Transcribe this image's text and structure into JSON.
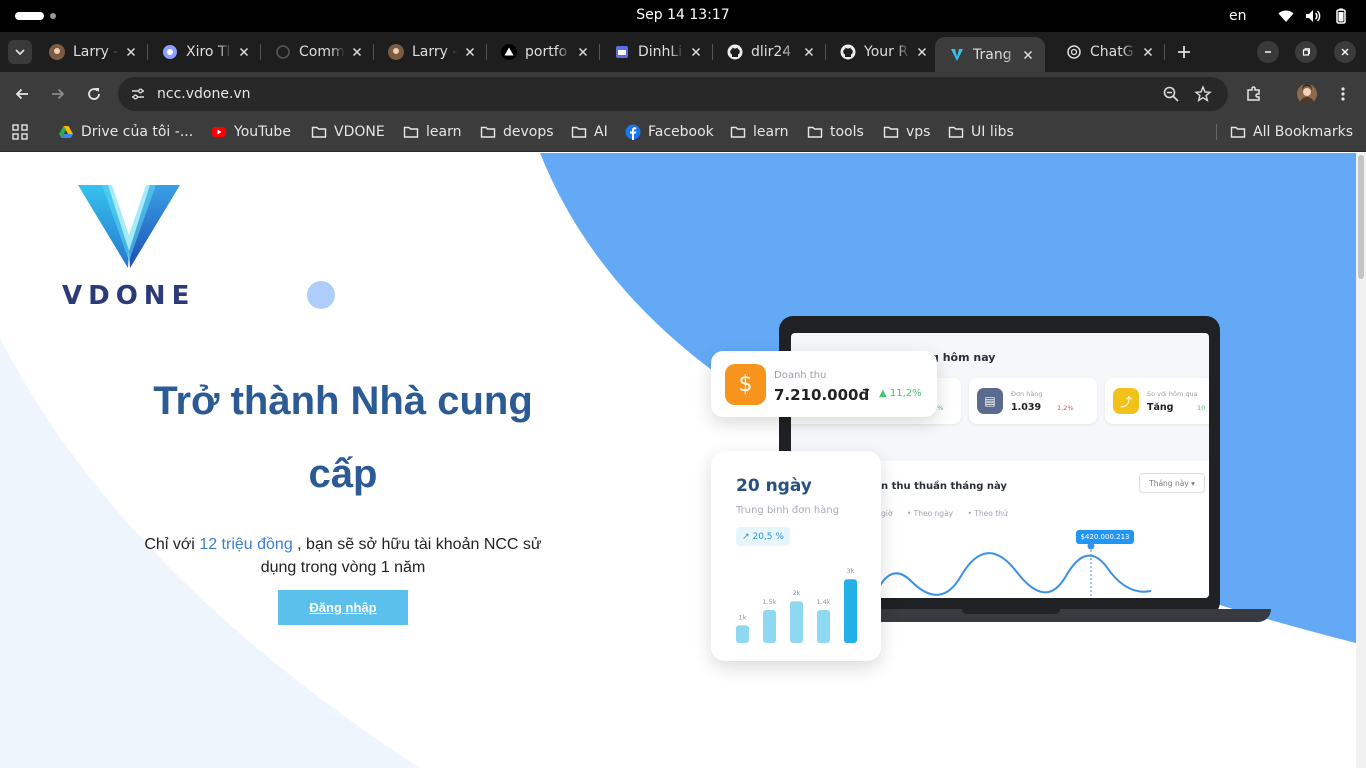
{
  "os": {
    "clock": "Sep 14  13:17",
    "lang": "en"
  },
  "tabs": [
    {
      "title": "Larry -",
      "icon": "avatar-icon"
    },
    {
      "title": "Xiro Tl",
      "icon": "xiro-icon"
    },
    {
      "title": "Comm",
      "icon": "loading-icon"
    },
    {
      "title": "Larry -",
      "icon": "avatar-icon"
    },
    {
      "title": "portfo",
      "icon": "vercel-icon"
    },
    {
      "title": "DinhLi",
      "icon": "window-icon"
    },
    {
      "title": "dlir24",
      "icon": "github-icon"
    },
    {
      "title": "Your R",
      "icon": "github-icon"
    },
    {
      "title": "Trang",
      "icon": "vdone-icon",
      "active": true
    },
    {
      "title": "ChatG",
      "icon": "chatgpt-icon"
    }
  ],
  "address": {
    "url": "ncc.vdone.vn"
  },
  "bookmarks": [
    {
      "label": "Drive của tôi -...",
      "icon": "drive-icon"
    },
    {
      "label": "YouTube",
      "icon": "youtube-icon"
    },
    {
      "label": "VDONE",
      "icon": "folder-icon"
    },
    {
      "label": "learn",
      "icon": "folder-icon"
    },
    {
      "label": "devops",
      "icon": "folder-icon"
    },
    {
      "label": "AI",
      "icon": "folder-icon"
    },
    {
      "label": "Facebook",
      "icon": "facebook-icon"
    },
    {
      "label": "learn",
      "icon": "folder-icon"
    },
    {
      "label": "tools",
      "icon": "folder-icon"
    },
    {
      "label": "vps",
      "icon": "folder-icon"
    },
    {
      "label": "UI libs",
      "icon": "folder-icon"
    }
  ],
  "all_bookmarks": "All Bookmarks",
  "page": {
    "logo_text": "VDONE",
    "heading_line1": "Trở thành Nhà cung",
    "heading_line2": "cấp",
    "desc_prefix": "Chỉ với ",
    "desc_highlight": "12 triệu đồng",
    "desc_suffix": " , bạn sẽ sở hữu tài khoản NCC sử dụng trong vòng 1 năm",
    "login_button": "Đăng nhập"
  },
  "mockup": {
    "screen_title": "g hôm nay",
    "orders_label": "Đơn hàng",
    "orders_value": "1.039",
    "orders_pct": "1,2%",
    "compare_label": "So với hôm qua",
    "compare_value": "Tăng",
    "compare_pct": "10",
    "rev_pct_partial": ",2%",
    "chart_title": "n thu thuần tháng này",
    "chart_select": "Tháng này ▾",
    "chart_tabs": [
      "giờ",
      "• Theo ngày",
      "• Theo thứ"
    ],
    "chart_tooltip": "$420.000.213",
    "revenue_label": "Doanh thu",
    "revenue_value": "7.210.000đ",
    "revenue_pct": "11,2%",
    "days_title": "20 ngày",
    "days_sub": "Trung bình đơn hàng",
    "days_badge": "↗ 20,5 %",
    "bars": [
      {
        "label": "1k",
        "value": 0.8
      },
      {
        "label": "1.5k",
        "value": 1.5
      },
      {
        "label": "2k",
        "value": 1.9
      },
      {
        "label": "1.4k",
        "value": 1.5
      },
      {
        "label": "3k",
        "value": 2.9
      }
    ]
  },
  "colors": {
    "brand_blue": "#2c5a94",
    "accent_sky": "#63a9f5",
    "button": "#5bc0eb",
    "highlight": "#3a7fd2"
  }
}
